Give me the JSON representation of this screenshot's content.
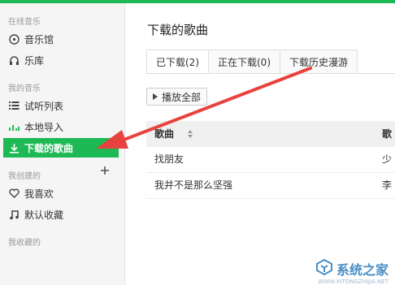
{
  "colors": {
    "accent": "#1db954",
    "arrow": "#e8423f"
  },
  "sidebar": {
    "sections": [
      {
        "label": "在线音乐"
      },
      {
        "label": "我的音乐"
      },
      {
        "label": "我创建的"
      },
      {
        "label": "我收藏的"
      }
    ],
    "items": [
      {
        "label": "音乐馆",
        "icon": "disc-icon"
      },
      {
        "label": "乐库",
        "icon": "headphones-icon"
      },
      {
        "label": "试听列表",
        "icon": "list-icon"
      },
      {
        "label": "本地导入",
        "icon": "equalizer-icon"
      },
      {
        "label": "下载的歌曲",
        "icon": "download-icon",
        "active": true
      },
      {
        "label": "我喜欢",
        "icon": "heart-icon"
      },
      {
        "label": "默认收藏",
        "icon": "music-note-icon"
      }
    ],
    "add_icon": "plus-icon"
  },
  "main": {
    "title": "下载的歌曲",
    "tabs": [
      {
        "label": "已下载(2)",
        "active": true
      },
      {
        "label": "正在下载(0)"
      },
      {
        "label": "下载历史漫游"
      }
    ],
    "play_all_label": "播放全部",
    "table": {
      "columns": [
        "歌曲",
        "歌"
      ],
      "rows": [
        {
          "song": "找朋友",
          "singer": "少"
        },
        {
          "song": "我并不是那么坚强",
          "singer": "李"
        }
      ]
    }
  },
  "watermark": {
    "text": "系统之家",
    "subtext": "WWW.XITONGZHIJIA.NET"
  }
}
